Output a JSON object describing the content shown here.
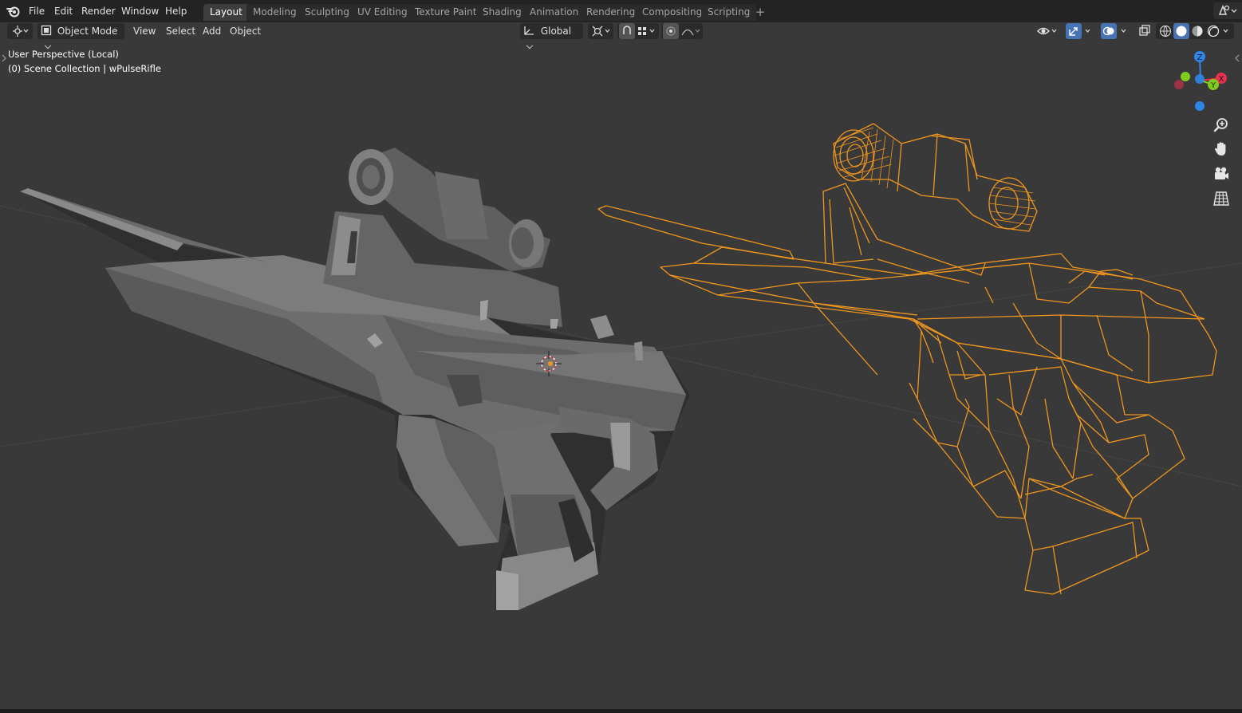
{
  "menubar": {
    "items": [
      "File",
      "Edit",
      "Render",
      "Window",
      "Help"
    ]
  },
  "workspaces": {
    "tabs": [
      "Layout",
      "Modeling",
      "Sculpting",
      "UV Editing",
      "Texture Paint",
      "Shading",
      "Animation",
      "Rendering",
      "Compositing",
      "Scripting"
    ],
    "active": "Layout"
  },
  "viewport_header": {
    "mode": "Object Mode",
    "menus": [
      "View",
      "Select",
      "Add",
      "Object"
    ],
    "transform_orientation": "Global"
  },
  "viewport_overlay": {
    "perspective": "User Perspective (Local)",
    "collection": "(0) Scene Collection | wPulseRifle"
  },
  "gizmo": {
    "axes": [
      "Z",
      "X",
      "Y"
    ]
  },
  "colors": {
    "accent": "#4772b3",
    "selection_wire": "#f0961e",
    "axis_x": "#e8334f",
    "axis_y": "#7fcc1f",
    "axis_z": "#2f86e8",
    "viewport_bg": "#393939"
  },
  "icons": [
    "blender-logo",
    "editor-type-icon",
    "object-mode-icon",
    "transform-orientation-icon",
    "pivot-icon",
    "snap-icon",
    "proportional-edit-icon",
    "visibility-icon",
    "gizmo-icon",
    "overlay-icon",
    "xray-icon",
    "shading-wireframe-icon",
    "shading-solid-icon",
    "shading-material-icon",
    "shading-rendered-icon",
    "zoom-icon",
    "hand-pan-icon",
    "camera-icon",
    "grid-icon"
  ]
}
